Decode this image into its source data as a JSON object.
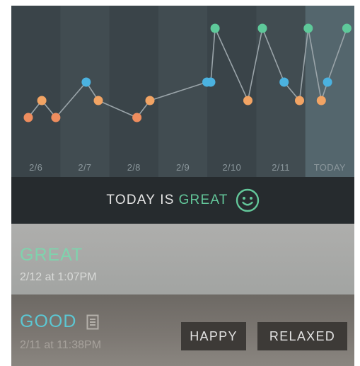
{
  "chart": {
    "days": [
      "2/6",
      "2/7",
      "2/8",
      "2/9",
      "2/10",
      "2/11",
      "TODAY"
    ],
    "mood_levels": {
      "great": 3,
      "good": 2,
      "okay": 1
    },
    "colors": {
      "great": "#5ec99a",
      "good": "#4bb2e0",
      "okay": "#f2a464",
      "low": "#ee8d5e",
      "line": "#9aa4a9",
      "band_dark": "#3a4449",
      "band_light": "#414c51",
      "today_band": "#54666d"
    },
    "points": [
      {
        "day": 0.0,
        "mood": "low"
      },
      {
        "day": 0.28,
        "mood": "okay"
      },
      {
        "day": 0.57,
        "mood": "low"
      },
      {
        "day": 1.2,
        "mood": "good"
      },
      {
        "day": 1.45,
        "mood": "okay"
      },
      {
        "day": 2.25,
        "mood": "low"
      },
      {
        "day": 2.52,
        "mood": "okay"
      },
      {
        "day": 3.7,
        "mood": "good"
      },
      {
        "day": 3.78,
        "mood": "good"
      },
      {
        "day": 3.87,
        "mood": "great"
      },
      {
        "day": 4.55,
        "mood": "okay"
      },
      {
        "day": 4.85,
        "mood": "great"
      },
      {
        "day": 5.3,
        "mood": "good"
      },
      {
        "day": 5.62,
        "mood": "okay"
      },
      {
        "day": 5.8,
        "mood": "great"
      },
      {
        "day": 6.07,
        "mood": "okay"
      },
      {
        "day": 6.2,
        "mood": "good"
      },
      {
        "day": 6.6,
        "mood": "great"
      }
    ]
  },
  "today": {
    "prefix": "TODAY IS",
    "mood": "GREAT"
  },
  "entries": [
    {
      "mood": "GREAT",
      "time": "2/12 at 1:07PM"
    },
    {
      "mood": "GOOD",
      "time": "2/11 at 11:38PM",
      "tags": [
        "HAPPY",
        "RELAXED"
      ]
    }
  ]
}
